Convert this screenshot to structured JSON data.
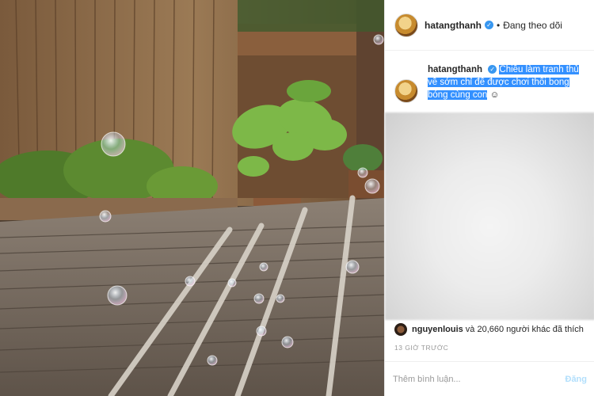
{
  "post": {
    "username": "hatangthanh",
    "separator": "•",
    "follow_status": "Đang theo dõi",
    "caption_user": "hatangthanh",
    "caption_text": "Chiều làm tranh thủ về sớm chỉ để được chơi thổi bong bóng cùng con",
    "likes_user": "nguyenlouis",
    "likes_rest": "và 20,660 người khác đã thích",
    "time": "13 GIỜ TRƯỚC",
    "comment_placeholder": "Thêm bình luận...",
    "post_label": "Đăng"
  }
}
